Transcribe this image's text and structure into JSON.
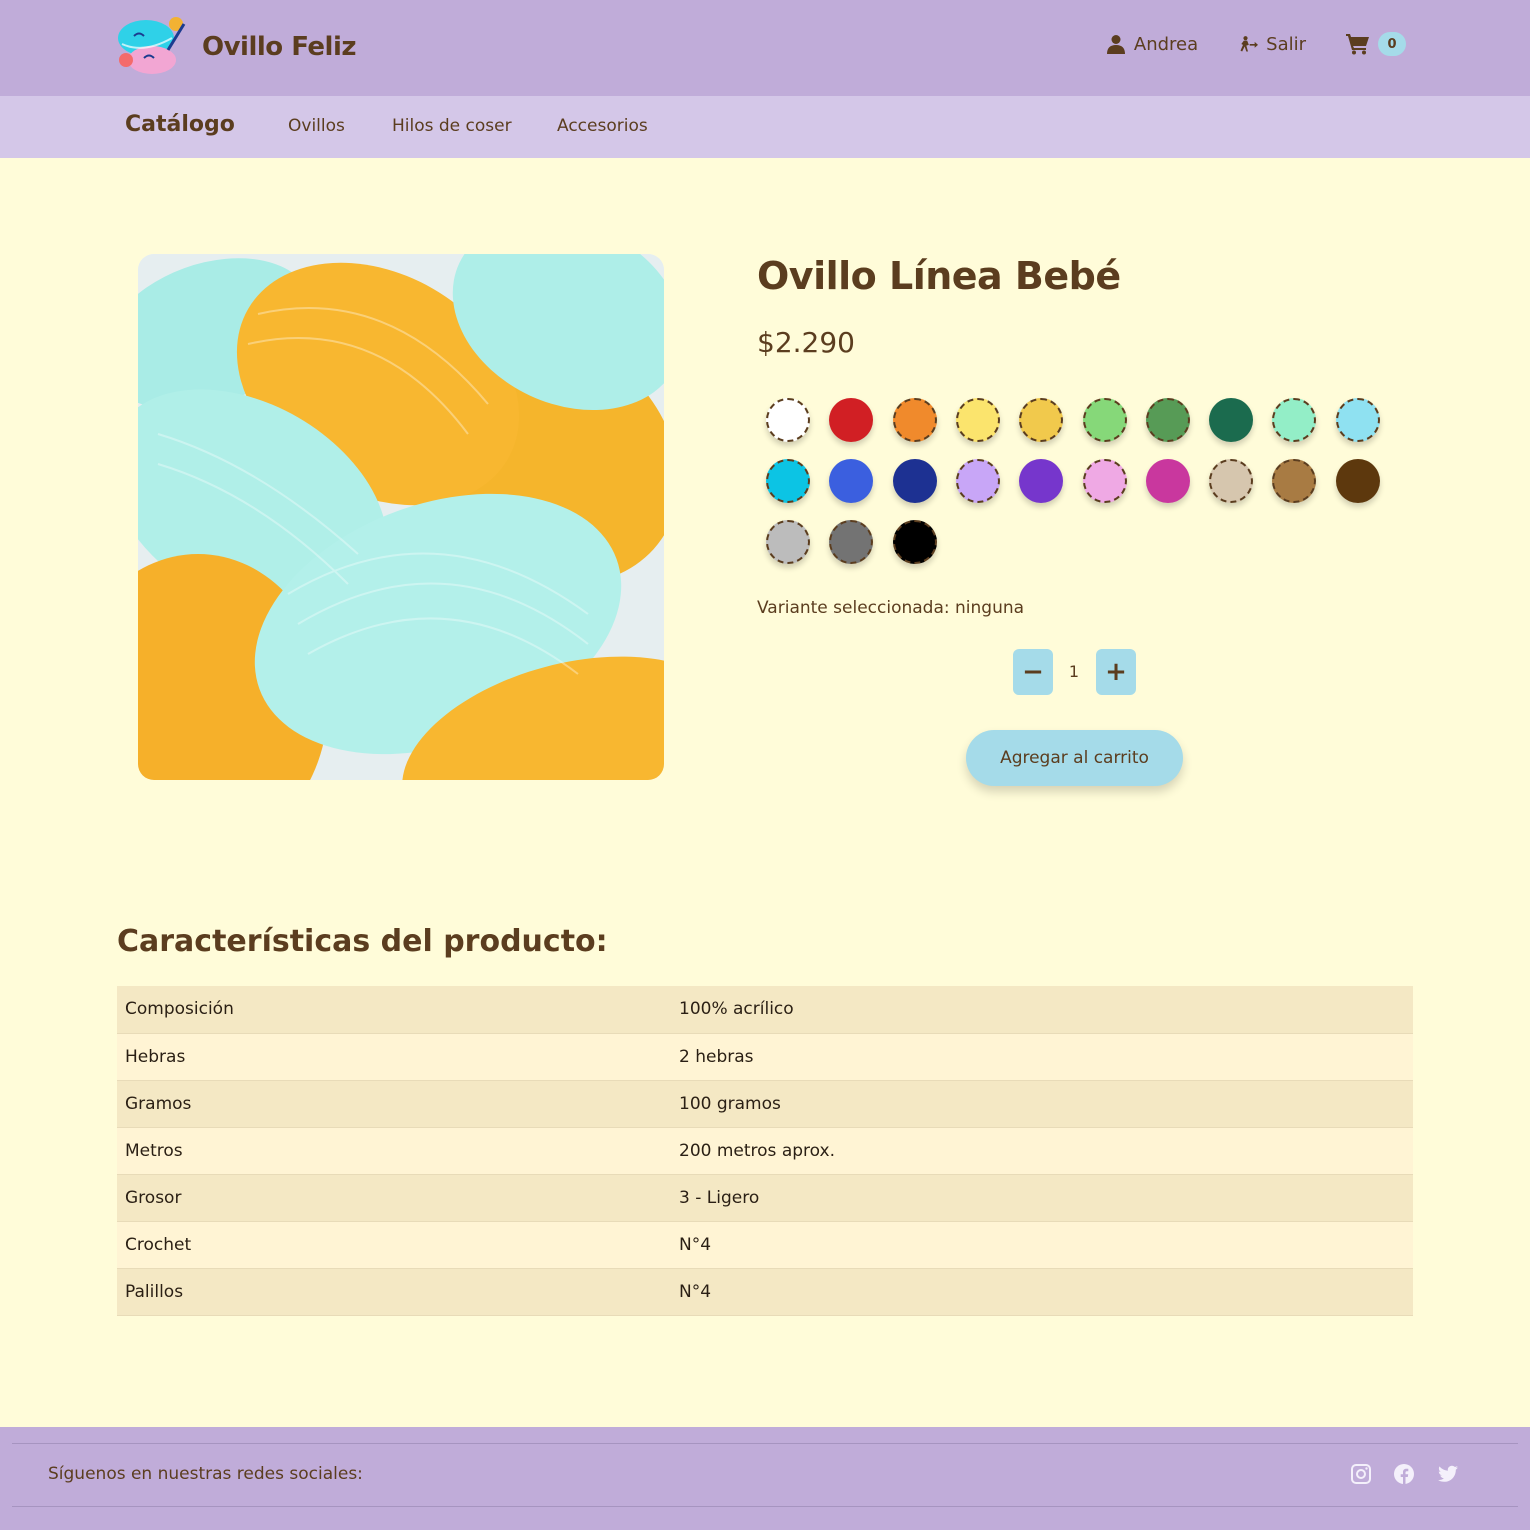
{
  "header": {
    "brand": "Ovillo Feliz",
    "user_label": "Andrea",
    "logout_label": "Salir",
    "cart_count": "0"
  },
  "subnav": {
    "brand": "Catálogo",
    "links": [
      "Ovillos",
      "Hilos de coser",
      "Accesorios"
    ]
  },
  "product": {
    "title": "Ovillo Línea Bebé",
    "price": "$2.290",
    "variant_text": "Variante seleccionada: ninguna",
    "quantity": "1",
    "add_to_cart_label": "Agregar al carrito",
    "swatches": [
      {
        "color": "#ffffff",
        "dashed": true
      },
      {
        "color": "#d11f24",
        "dashed": false
      },
      {
        "color": "#f08a2c",
        "dashed": true
      },
      {
        "color": "#fbe46d",
        "dashed": true
      },
      {
        "color": "#f1c94c",
        "dashed": true
      },
      {
        "color": "#86d879",
        "dashed": true
      },
      {
        "color": "#579b56",
        "dashed": true
      },
      {
        "color": "#1b6b4e",
        "dashed": false
      },
      {
        "color": "#93eec7",
        "dashed": true
      },
      {
        "color": "#8fe1f1",
        "dashed": true
      },
      {
        "color": "#0cc4e4",
        "dashed": true
      },
      {
        "color": "#3b5fdf",
        "dashed": false
      },
      {
        "color": "#1d3192",
        "dashed": false
      },
      {
        "color": "#c8a6f7",
        "dashed": true
      },
      {
        "color": "#7636cc",
        "dashed": false
      },
      {
        "color": "#efa9e4",
        "dashed": true
      },
      {
        "color": "#c9379e",
        "dashed": false
      },
      {
        "color": "#d6c6ae",
        "dashed": true
      },
      {
        "color": "#a87b43",
        "dashed": true
      },
      {
        "color": "#5d380d",
        "dashed": false
      },
      {
        "color": "#bcbcbc",
        "dashed": true
      },
      {
        "color": "#737373",
        "dashed": true
      },
      {
        "color": "#000000",
        "dashed": true
      }
    ]
  },
  "characteristics": {
    "title": "Características del producto:",
    "rows": [
      {
        "key": "Composición",
        "value": "100% acrílico"
      },
      {
        "key": "Hebras",
        "value": "2 hebras"
      },
      {
        "key": "Gramos",
        "value": "100 gramos"
      },
      {
        "key": "Metros",
        "value": "200 metros aprox."
      },
      {
        "key": "Grosor",
        "value": "3 - Ligero"
      },
      {
        "key": "Crochet",
        "value": "N°4"
      },
      {
        "key": "Palillos",
        "value": "N°4"
      }
    ]
  },
  "footer": {
    "text": "Síguenos en nuestras redes sociales:",
    "social": [
      "instagram-icon",
      "facebook-icon",
      "twitter-icon"
    ]
  },
  "colors": {
    "header_bg": "#c0acd9",
    "subnav_bg": "#d4c7e8",
    "page_bg": "#fffcd9",
    "accent": "#a5dbe9",
    "text": "#5b3d1f"
  }
}
